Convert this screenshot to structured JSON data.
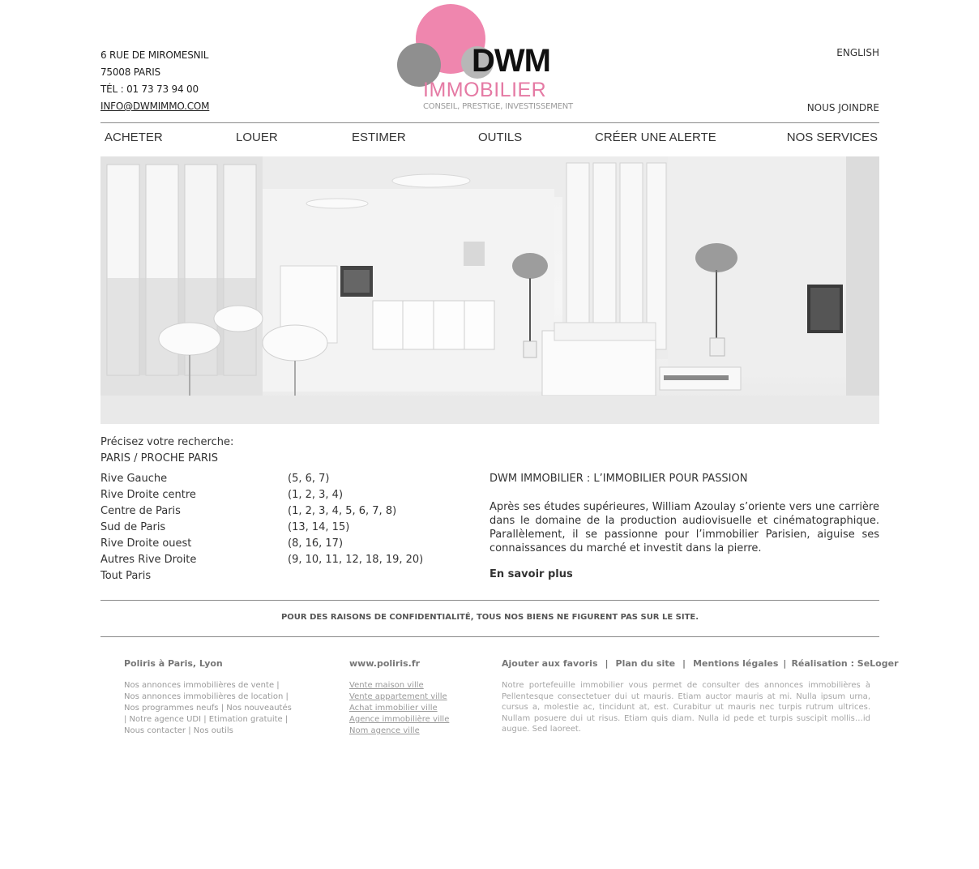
{
  "header": {
    "address_line1": "6 RUE DE MIROMESNIL",
    "address_line2": "75008 PARIS",
    "phone": "TÉL : 01 73 73 94 00",
    "email": "INFO@DWMIMMO.COM",
    "logo_main": "DWM",
    "logo_sub": "IMMOBILIER",
    "logo_tagline": "CONSEIL, PRESTIGE, INVESTISSEMENT",
    "language_link": "ENGLISH",
    "contact_link": "NOUS JOINDRE"
  },
  "nav": {
    "items": [
      "ACHETER",
      "LOUER",
      "ESTIMER",
      "OUTILS",
      "CRÉER UNE ALERTE",
      "NOS SERVICES"
    ]
  },
  "search": {
    "intro": "Précisez votre recherche:",
    "subtitle": "PARIS / PROCHE PARIS",
    "zones": [
      {
        "name": "Rive Gauche",
        "arr": "(5, 6, 7)"
      },
      {
        "name": "Rive Droite centre",
        "arr": "(1, 2, 3, 4)"
      },
      {
        "name": "Centre de Paris",
        "arr": "(1, 2, 3, 4, 5, 6, 7, 8)"
      },
      {
        "name": "Sud de Paris",
        "arr": "(13, 14, 15)"
      },
      {
        "name": "Rive Droite ouest",
        "arr": "(8, 16, 17)"
      },
      {
        "name": "Autres Rive Droite",
        "arr": "(9, 10, 11, 12, 18, 19, 20)"
      },
      {
        "name": "Tout Paris",
        "arr": ""
      }
    ]
  },
  "about": {
    "title": "DWM IMMOBILIER : L’IMMOBILIER POUR PASSION",
    "text": "Après ses études supérieures, William Azoulay s’oriente vers une carrière dans le domaine de la production audiovisuelle et cinématographique. Parallèlement, il se passionne pour l’immobilier Parisien, aiguise ses connaissances du marché et investit dans la pierre.",
    "more": "En savoir plus"
  },
  "notice": "POUR DES RAISONS DE CONFIDENTIALITÉ, TOUS NOS BIENS NE FIGURENT PAS SUR LE SITE.",
  "footer": {
    "col1": {
      "heading": "Poliris à Paris, Lyon",
      "lines": [
        "Nos annonces immobilières de vente |",
        "Nos annonces immobilières de location |",
        "Nos programmes neufs | Nos nouveautés",
        "| Notre agence UDI | Etimation gratuite |",
        "Nous contacter | Nos outils"
      ]
    },
    "col2": {
      "heading": "www.poliris.fr",
      "links": [
        "Vente maison ville",
        "Vente appartement ville",
        "Achat immobilier ville",
        "Agence immobilière ville",
        "Nom agence ville"
      ]
    },
    "col3": {
      "links": [
        "Ajouter aux favoris",
        "Plan du site",
        "Mentions légales",
        "Réalisation : SeLoger"
      ],
      "separator": "|",
      "text": "Notre portefeuille immobilier vous permet de consulter des annonces immobilières à Pellentesque consectetuer dui ut mauris. Etiam auctor mauris at mi. Nulla ipsum urna, cursus a, molestie ac, tincidunt at, est. Curabitur ut mauris nec turpis rutrum ultrices. Nullam posuere dui ut risus. Etiam quis diam. Nulla id pede et turpis suscipit mollis…id augue. Sed laoreet."
    }
  },
  "colors": {
    "logo_pink": "#ef86ae",
    "logo_gray": "#8f8f8f",
    "rule": "#8a8a8a"
  }
}
